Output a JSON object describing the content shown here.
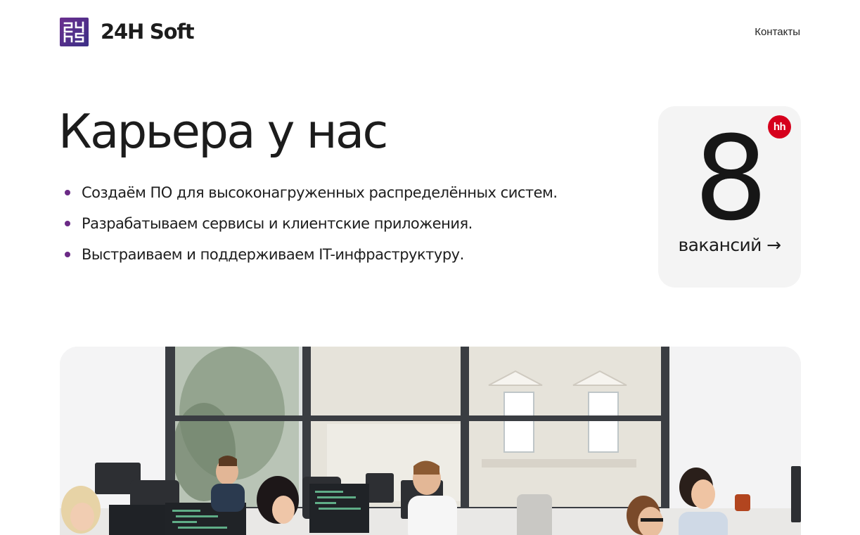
{
  "header": {
    "brand_name": "24H Soft",
    "logo_text": "24HS",
    "nav": {
      "contacts_label": "Контакты"
    }
  },
  "hero": {
    "title": "Карьера у нас",
    "features": [
      "Создаём ПО для высоконагруженных распределённых систем.",
      "Разрабатываем сервисы и клиентские приложения.",
      "Выстраиваем и поддерживаем IT-инфраструктуру."
    ]
  },
  "vacancies": {
    "count": "8",
    "label": "вакансий →",
    "badge": "hh"
  },
  "colors": {
    "accent": "#6b2a86",
    "hh_red": "#d6001c",
    "card_bg": "#f4f4f4"
  }
}
